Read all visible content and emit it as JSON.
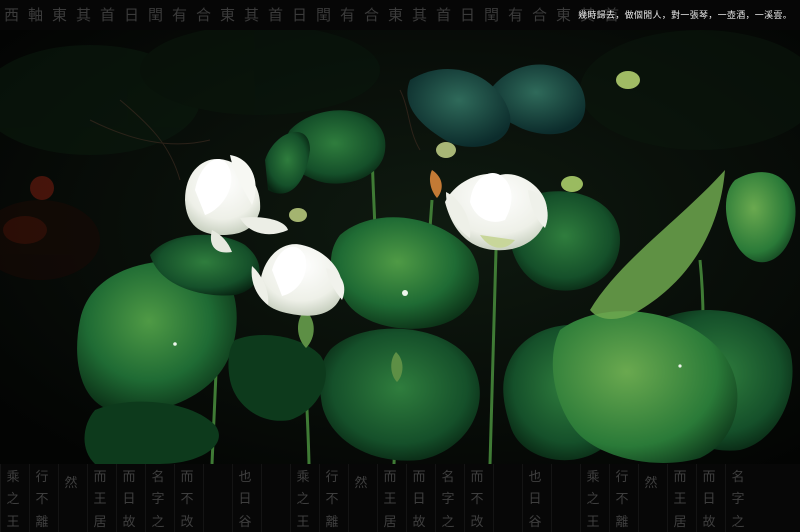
{
  "caption": "幾時歸去，做個閒人，對一張琴，一壺酒，一溪雲。",
  "top_strip_chars": "西軸東其首日閏有合東其首日閏有合東其首日閏有合東其首",
  "bottom_strip_columns": [
    [
      "乘",
      "之",
      "王"
    ],
    [
      "行",
      "不",
      "離"
    ],
    [
      "然",
      "",
      ""
    ],
    [
      "而",
      "王",
      "居"
    ],
    [
      "而",
      "日",
      "故"
    ],
    [
      "名",
      "字",
      "之"
    ],
    [
      "而",
      "不",
      "改"
    ],
    [
      "",
      "",
      " "
    ],
    [
      "也",
      "日",
      "谷"
    ],
    [
      "",
      "",
      " "
    ],
    [
      "乘",
      "之",
      "王"
    ],
    [
      "行",
      "不",
      "離"
    ],
    [
      "然",
      "",
      ""
    ],
    [
      "而",
      "王",
      "居"
    ],
    [
      "而",
      "日",
      "故"
    ],
    [
      "名",
      "字",
      "之"
    ],
    [
      "而",
      "不",
      "改"
    ],
    [
      "",
      "",
      " "
    ],
    [
      "也",
      "日",
      "谷"
    ],
    [
      "",
      "",
      " "
    ],
    [
      "乘",
      "之",
      "王"
    ],
    [
      "行",
      "不",
      "離"
    ],
    [
      "然",
      "",
      ""
    ],
    [
      "而",
      "王",
      "居"
    ],
    [
      "而",
      "日",
      "故"
    ],
    [
      "名",
      "字",
      "之"
    ]
  ],
  "colors": {
    "background": "#050505",
    "leaf_dark": "#0d3a1c",
    "leaf_mid": "#1f6b34",
    "leaf_light": "#5a9e4a",
    "petal": "#f4f5f0",
    "petal_shadow": "#c9d2c0"
  }
}
